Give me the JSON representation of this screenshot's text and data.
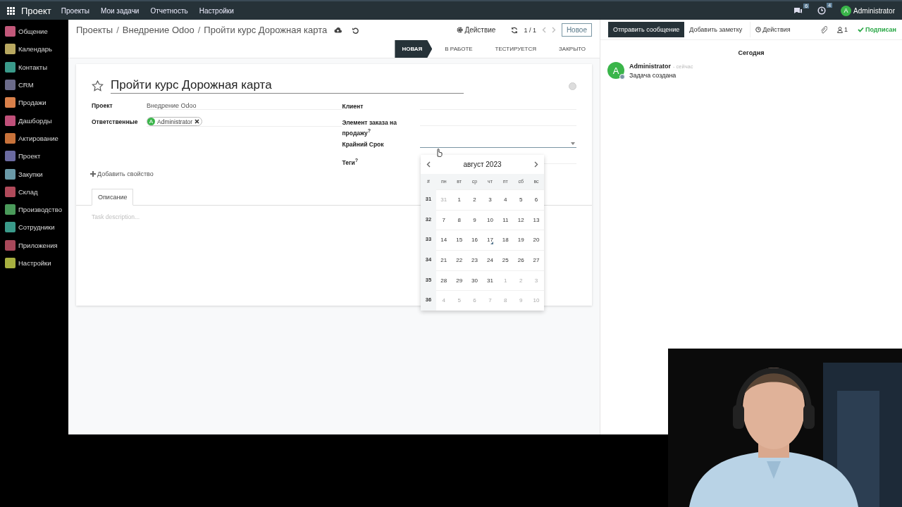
{
  "topbar": {
    "app_name": "Проект",
    "menu": [
      "Проекты",
      "Мои задачи",
      "Отчетность",
      "Настройки"
    ],
    "messages_count": "6",
    "activities_count": "4",
    "user_initial": "A",
    "user": "Administrator"
  },
  "sidebar": {
    "items": [
      {
        "label": "Общение",
        "color": "#c2587a"
      },
      {
        "label": "Календарь",
        "color": "#b8a860"
      },
      {
        "label": "Контакты",
        "color": "#3a9a8a"
      },
      {
        "label": "CRM",
        "color": "#6b6b8a"
      },
      {
        "label": "Продажи",
        "color": "#d9804a"
      },
      {
        "label": "Дашборды",
        "color": "#c0507a"
      },
      {
        "label": "Актирование",
        "color": "#c8723a"
      },
      {
        "label": "Проект",
        "color": "#6a6aa0"
      },
      {
        "label": "Закупки",
        "color": "#6a9aa8"
      },
      {
        "label": "Склад",
        "color": "#b04a5a"
      },
      {
        "label": "Производство",
        "color": "#4a9a5a"
      },
      {
        "label": "Сотрудники",
        "color": "#3a9a8a"
      },
      {
        "label": "Приложения",
        "color": "#a8485a"
      },
      {
        "label": "Настройки",
        "color": "#a8b040"
      }
    ]
  },
  "breadcrumbs": [
    "Проекты",
    "Внедрение Odoo",
    "Пройти курс Дорожная карта"
  ],
  "breadcrumb_separator": "/",
  "toolbar": {
    "action": "Действие",
    "pager": "1 / 1",
    "new_button": "Новое"
  },
  "stages": [
    {
      "label": "НОВАЯ",
      "selected": true
    },
    {
      "label": "В РАБОТЕ",
      "selected": false
    },
    {
      "label": "ТЕСТИРУЕТСЯ",
      "selected": false
    },
    {
      "label": "ЗАКРЫТО",
      "selected": false
    }
  ],
  "task": {
    "title": "Пройти курс Дорожная карта",
    "starred": false,
    "fields_left": [
      {
        "kind": "text",
        "label": "Проект",
        "value": "Внедрение Odoo"
      },
      {
        "kind": "tags",
        "label": "Ответственные",
        "tags": [
          {
            "initial": "A",
            "name": "Administrator"
          }
        ]
      }
    ],
    "fields_right": [
      {
        "kind": "text",
        "label": "Клиент"
      },
      {
        "kind": "text",
        "label": "Элемент заказа на продажу$^{?}$"
      },
      {
        "kind": "date",
        "label": "Крайний Срок"
      },
      {
        "kind": "text",
        "label": "Теги$^{?}$"
      }
    ],
    "add_property": "Добавить свойство",
    "tabs": [
      {
        "label": "Описание",
        "selected": true
      }
    ],
    "description_placeholder": "Task description..."
  },
  "datepicker": {
    "month": "август 2023",
    "header": [
      "#",
      "пн",
      "вт",
      "ср",
      "чт",
      "пт",
      "сб",
      "вс"
    ],
    "weeks": [
      {
        "number": "31",
        "days": [
          {
            "day": "31",
            "outside": true,
            "today": false
          },
          {
            "day": "1",
            "outside": false,
            "today": false
          },
          {
            "day": "2",
            "outside": false,
            "today": false
          },
          {
            "day": "3",
            "outside": false,
            "today": false
          },
          {
            "day": "4",
            "outside": false,
            "today": false
          },
          {
            "day": "5",
            "outside": false,
            "today": false
          },
          {
            "day": "6",
            "outside": false,
            "today": false
          }
        ]
      },
      {
        "number": "32",
        "days": [
          {
            "day": "7",
            "outside": false,
            "today": false
          },
          {
            "day": "8",
            "outside": false,
            "today": false
          },
          {
            "day": "9",
            "outside": false,
            "today": false
          },
          {
            "day": "10",
            "outside": false,
            "today": false
          },
          {
            "day": "11",
            "outside": false,
            "today": false
          },
          {
            "day": "12",
            "outside": false,
            "today": false
          },
          {
            "day": "13",
            "outside": false,
            "today": false
          }
        ]
      },
      {
        "number": "33",
        "days": [
          {
            "day": "14",
            "outside": false,
            "today": false
          },
          {
            "day": "15",
            "outside": false,
            "today": false
          },
          {
            "day": "16",
            "outside": false,
            "today": false
          },
          {
            "day": "17",
            "outside": false,
            "today": true
          },
          {
            "day": "18",
            "outside": false,
            "today": false
          },
          {
            "day": "19",
            "outside": false,
            "today": false
          },
          {
            "day": "20",
            "outside": false,
            "today": false
          }
        ]
      },
      {
        "number": "34",
        "days": [
          {
            "day": "21",
            "outside": false,
            "today": false
          },
          {
            "day": "22",
            "outside": false,
            "today": false
          },
          {
            "day": "23",
            "outside": false,
            "today": false
          },
          {
            "day": "24",
            "outside": false,
            "today": false
          },
          {
            "day": "25",
            "outside": false,
            "today": false
          },
          {
            "day": "26",
            "outside": false,
            "today": false
          },
          {
            "day": "27",
            "outside": false,
            "today": false
          }
        ]
      },
      {
        "number": "35",
        "days": [
          {
            "day": "28",
            "outside": false,
            "today": false
          },
          {
            "day": "29",
            "outside": false,
            "today": false
          },
          {
            "day": "30",
            "outside": false,
            "today": false
          },
          {
            "day": "31",
            "outside": false,
            "today": false
          },
          {
            "day": "1",
            "outside": true,
            "today": false
          },
          {
            "day": "2",
            "outside": true,
            "today": false
          },
          {
            "day": "3",
            "outside": true,
            "today": false
          }
        ]
      },
      {
        "number": "36",
        "days": [
          {
            "day": "4",
            "outside": true,
            "today": false
          },
          {
            "day": "5",
            "outside": true,
            "today": false
          },
          {
            "day": "6",
            "outside": true,
            "today": false
          },
          {
            "day": "7",
            "outside": true,
            "today": false
          },
          {
            "day": "8",
            "outside": true,
            "today": false
          },
          {
            "day": "9",
            "outside": true,
            "today": false
          },
          {
            "day": "10",
            "outside": true,
            "today": false
          }
        ]
      }
    ]
  },
  "chatter": {
    "buttons": [
      {
        "kind": "primary",
        "label": "Отправить сообщение"
      },
      {
        "kind": "secondary",
        "label": "Добавить заметку"
      },
      {
        "kind": "activity",
        "label": "Действия"
      }
    ],
    "followers_count": "1",
    "follow_label": "Подписан",
    "date_separator": "Сегодня",
    "messages": [
      {
        "initial": "A",
        "author": "Administrator",
        "time": "- сейчас",
        "body": "Задача создана"
      }
    ]
  },
  "webcam": {
    "kind": "picture"
  }
}
